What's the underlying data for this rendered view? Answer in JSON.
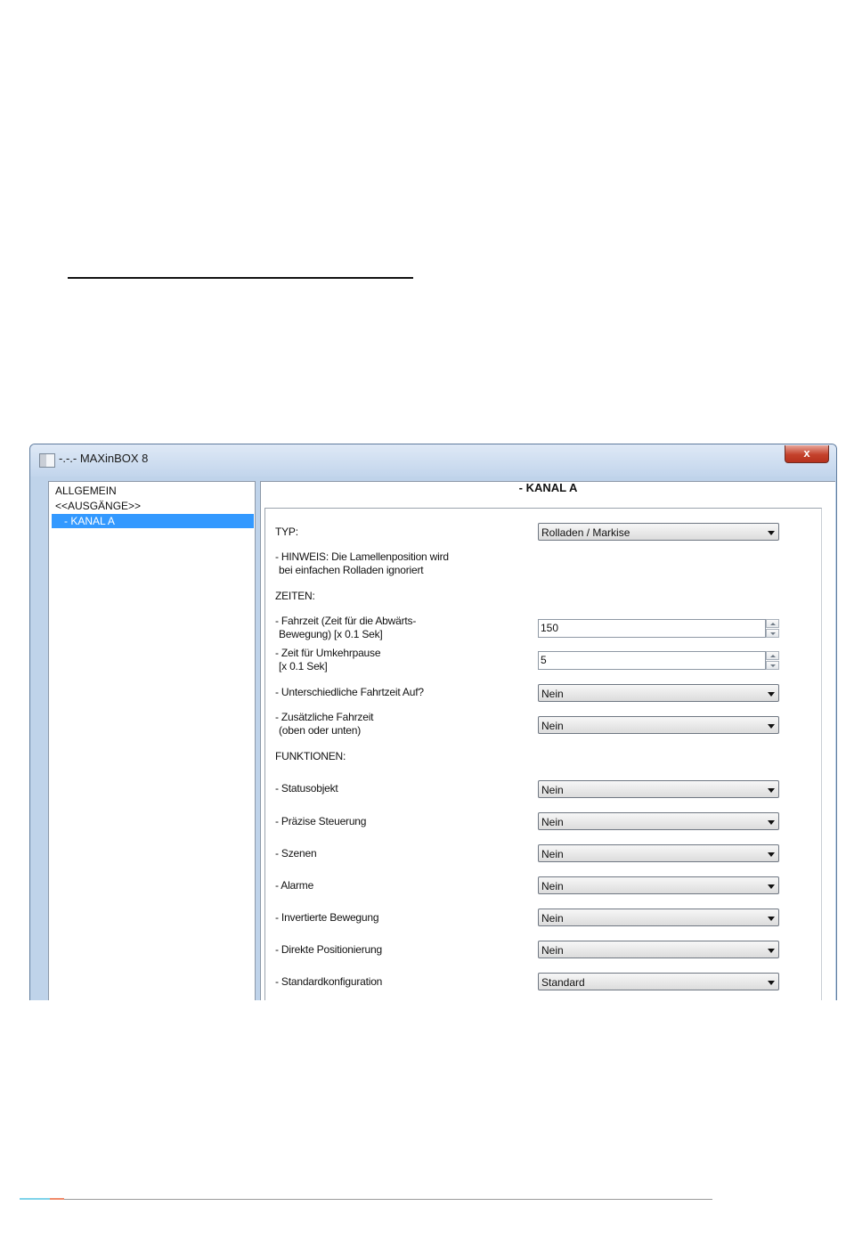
{
  "window": {
    "title": "-.-.- MAXinBOX 8",
    "close_glyph": "x"
  },
  "tree": {
    "items": [
      {
        "label": "ALLGEMEIN"
      },
      {
        "label": "<<AUSGÄNGE>>"
      },
      {
        "label": "- KANAL A"
      }
    ]
  },
  "panel": {
    "title": "- KANAL A",
    "typ": {
      "label": "TYP:",
      "value": "Rolladen / Markise"
    },
    "hinweis": {
      "line1": "- HINWEIS: Die Lamellenposition wird",
      "line2": "bei einfachen Rolladen ignoriert"
    },
    "zeiten_heading": "ZEITEN:",
    "fahrzeit": {
      "line1": "- Fahrzeit (Zeit für die Abwärts-",
      "line2": "Bewegung) [x 0.1 Sek]",
      "value": "150"
    },
    "umkehrpause": {
      "line1": "- Zeit für Umkehrpause",
      "line2": "[x 0.1 Sek]",
      "value": "5"
    },
    "unterschiedliche": {
      "label": "- Unterschiedliche Fahrtzeit Auf?",
      "value": "Nein"
    },
    "zusaetzliche": {
      "line1": "- Zusätzliche Fahrzeit",
      "line2": "(oben oder unten)",
      "value": "Nein"
    },
    "funktionen_heading": "FUNKTIONEN:",
    "functions": [
      {
        "label": "- Statusobjekt",
        "value": "Nein"
      },
      {
        "label": "- Präzise Steuerung",
        "value": "Nein"
      },
      {
        "label": "- Szenen",
        "value": "Nein"
      },
      {
        "label": "- Alarme",
        "value": "Nein"
      },
      {
        "label": "- Invertierte Bewegung",
        "value": "Nein"
      },
      {
        "label": "- Direkte Positionierung",
        "value": "Nein"
      },
      {
        "label": "- Standardkonfiguration",
        "value": "Standard"
      }
    ]
  }
}
